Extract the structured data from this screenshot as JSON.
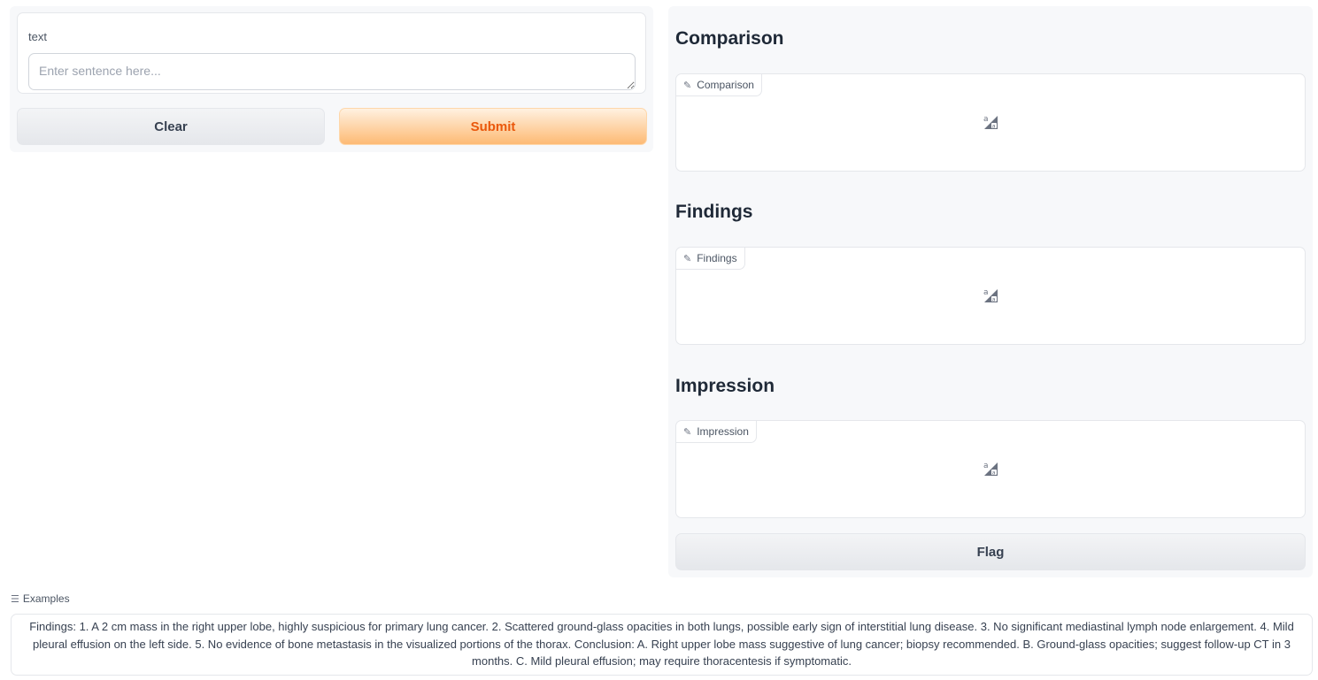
{
  "input": {
    "label": "text",
    "placeholder": "Enter sentence here...",
    "value": ""
  },
  "buttons": {
    "clear_label": "Clear",
    "submit_label": "Submit",
    "flag_label": "Flag"
  },
  "outputs": [
    {
      "heading": "Comparison",
      "tag": "Comparison",
      "icon": "text-label-icon"
    },
    {
      "heading": "Findings",
      "tag": "Findings",
      "icon": "text-label-icon"
    },
    {
      "heading": "Impression",
      "tag": "Impression",
      "icon": "text-label-icon"
    }
  ],
  "examples": {
    "label": "Examples",
    "items": [
      "Findings: 1. A 2 cm mass in the right upper lobe, highly suspicious for primary lung cancer. 2. Scattered ground-glass opacities in both lungs, possible early sign of interstitial lung disease. 3. No significant mediastinal lymph node enlargement. 4. Mild pleural effusion on the left side. 5. No evidence of bone metastasis in the visualized portions of the thorax. Conclusion: A. Right upper lobe mass suggestive of lung cancer; biopsy recommended. B. Ground-glass opacities; suggest follow-up CT in 3 months. C. Mild pleural effusion; may require thoracentesis if symptomatic."
    ]
  },
  "colors": {
    "submit_text": "#ea580c",
    "submit_bg": "#fdba74",
    "panel_bg": "#f7f8fa"
  }
}
